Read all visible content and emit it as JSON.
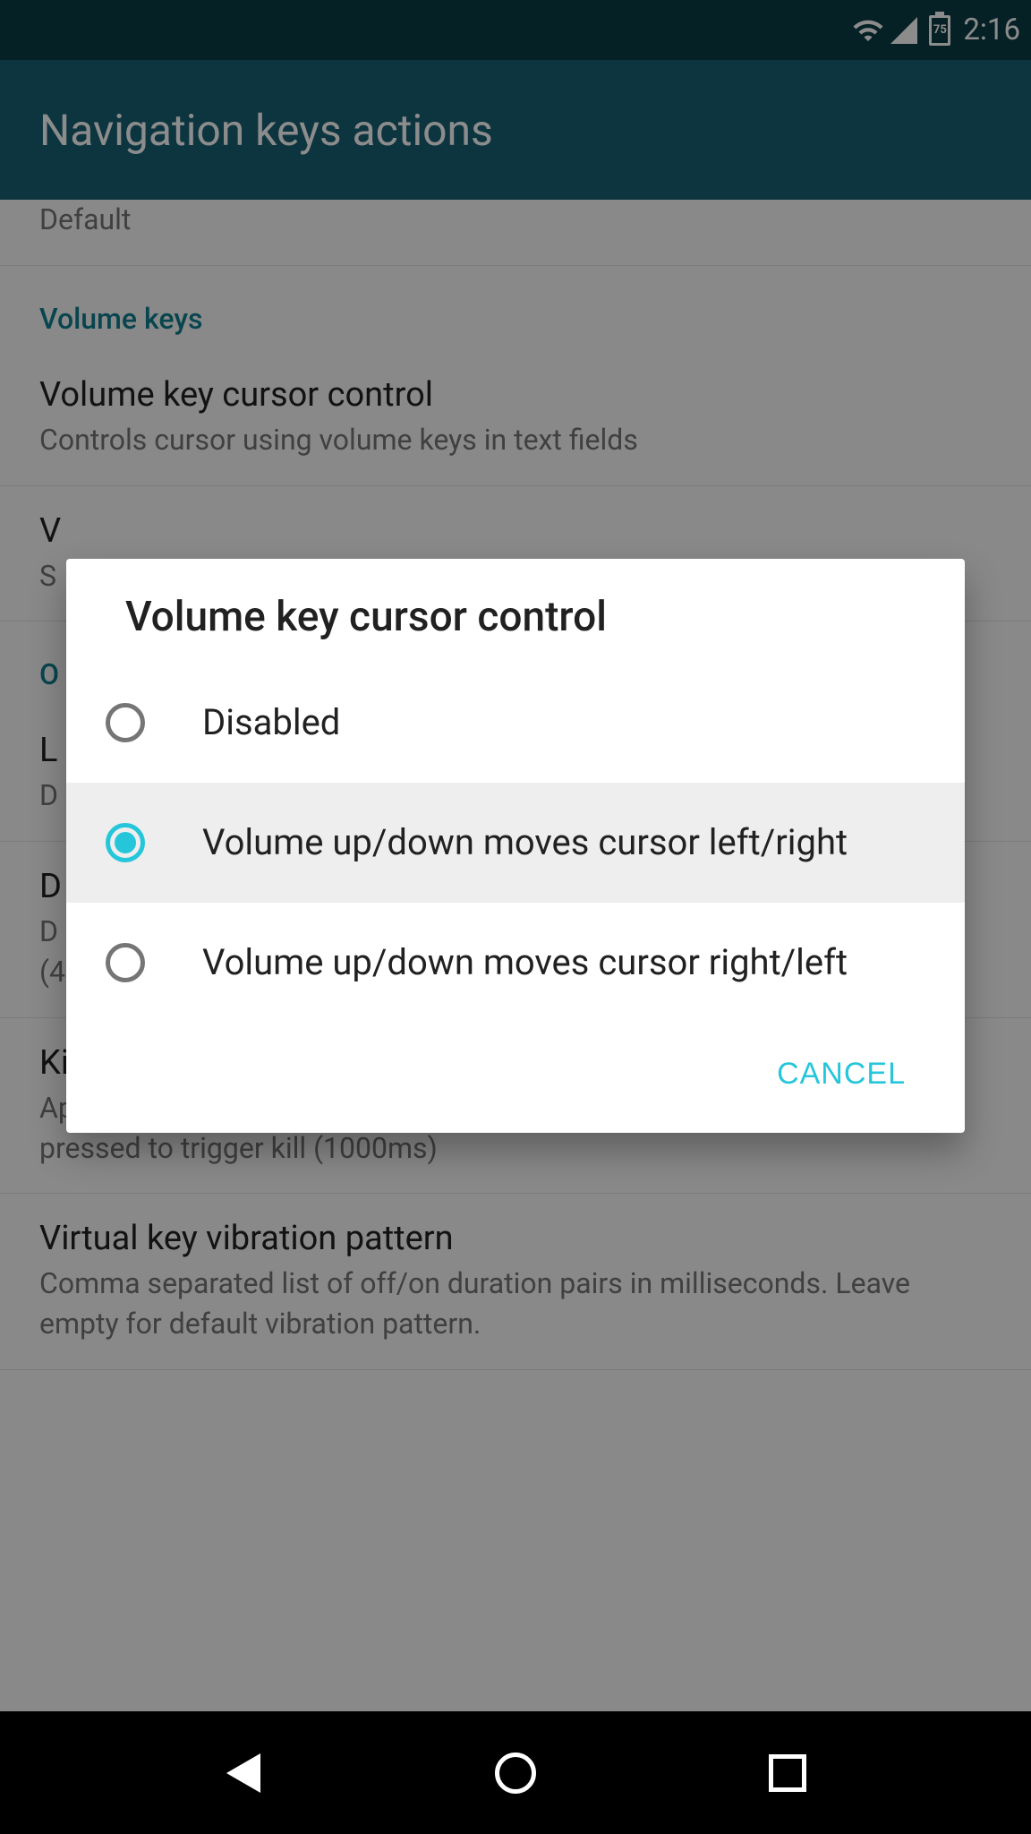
{
  "status": {
    "battery": "75",
    "time": "2:16"
  },
  "header": {
    "title": "Navigation keys actions"
  },
  "bg": {
    "item0_summary": "Default",
    "cat1": "Volume keys",
    "item1_title": "Volume key cursor control",
    "item1_summary": "Controls cursor using volume keys in text fields",
    "item2_title_cut": "V",
    "item2_summary_cut": "S",
    "cat2_cut": "O",
    "item3_title_cut": "L",
    "item3_summary_cut": "D",
    "item4_title_cut": "D",
    "item4_summary1_cut": "D",
    "item4_summary2_cut": "(4",
    "item5_title": "Kill app long-press delay",
    "item5_summary": "Applies to Kill foreground app action. Defines for how long key must be pressed to trigger kill (1000ms)",
    "item6_title": "Virtual key vibration pattern",
    "item6_summary": "Comma separated list of off/on duration pairs in milliseconds. Leave empty for default vibration pattern."
  },
  "dialog": {
    "title": "Volume key cursor control",
    "options": {
      "opt0": "Disabled",
      "opt1": "Volume up/down moves cursor left/right",
      "opt2": "Volume up/down moves cursor right/left"
    },
    "selected_index": 1,
    "cancel": "CANCEL"
  }
}
